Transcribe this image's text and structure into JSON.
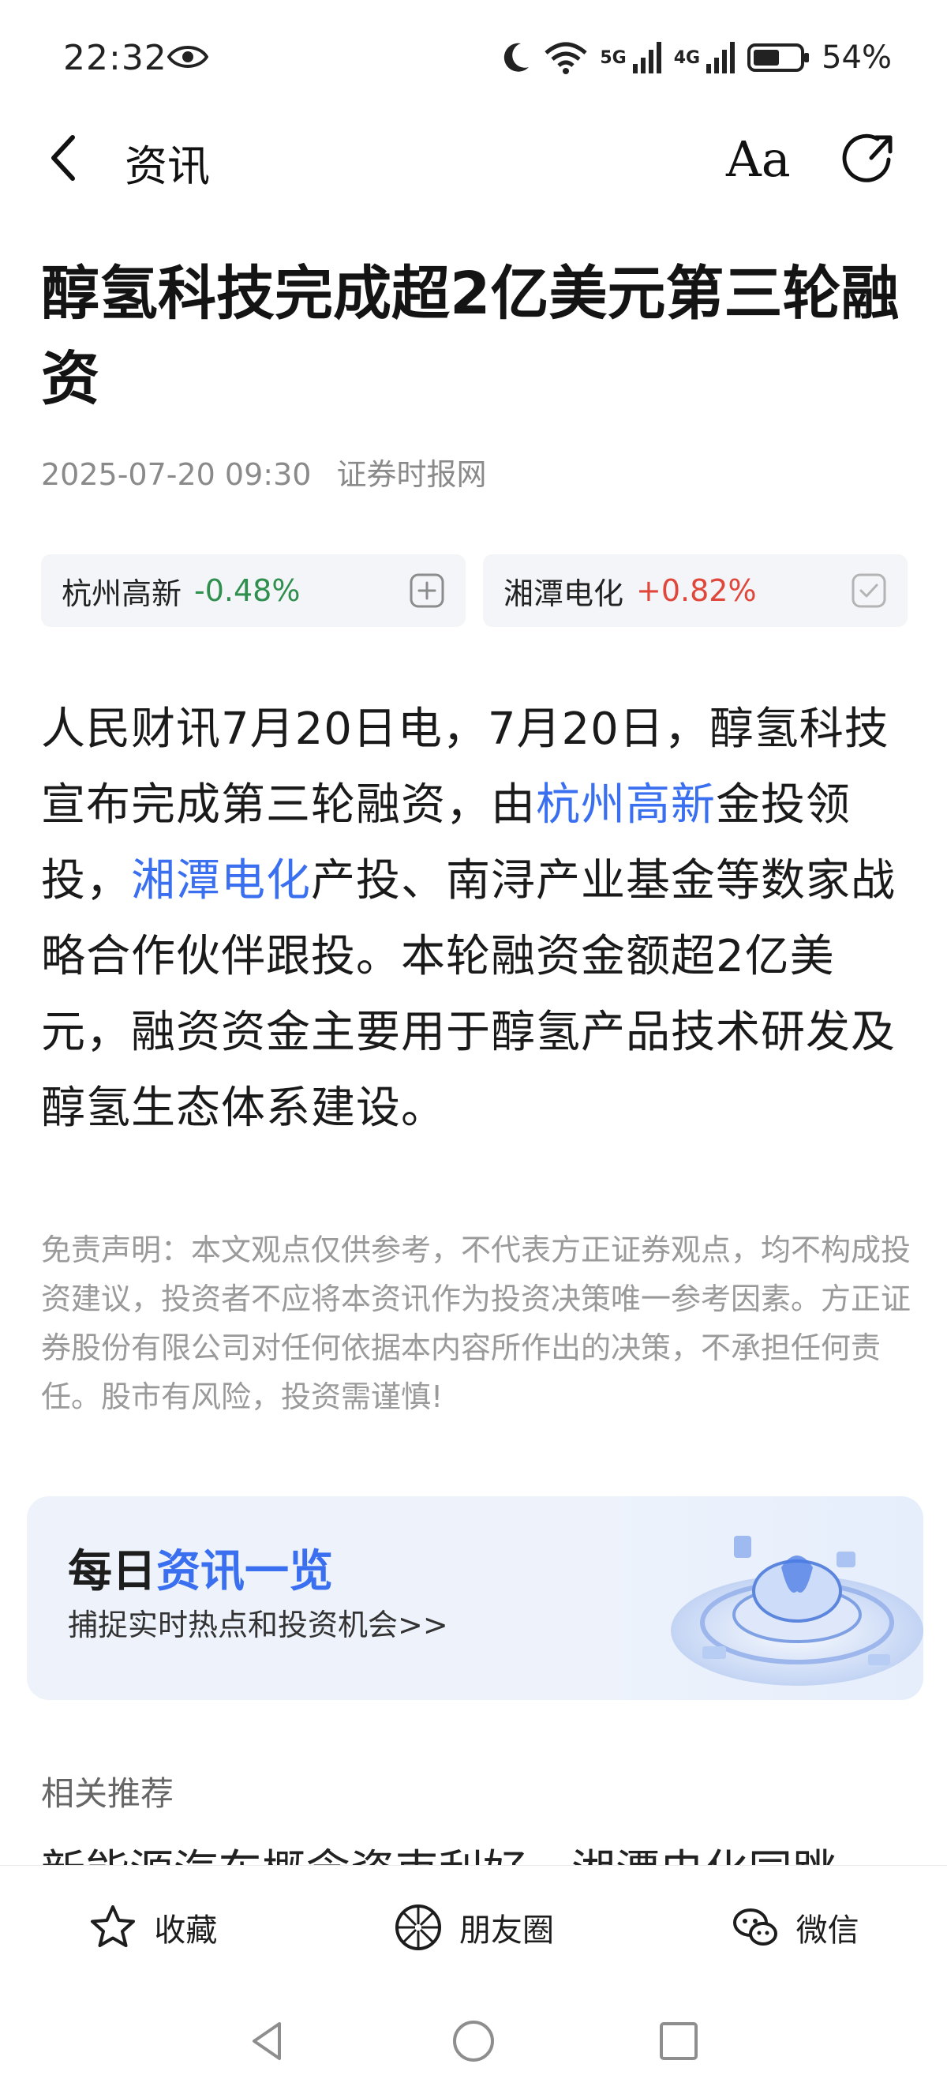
{
  "status_bar": {
    "time": "22:32",
    "net1": "5G",
    "net2": "4G",
    "battery": "54%"
  },
  "nav": {
    "title": "资讯",
    "font_icon_text": "Aa"
  },
  "article": {
    "title": "醇氢科技完成超2亿美元第三轮融资",
    "date": "2025-07-20 09:30",
    "source": "证券时报网",
    "stocks": [
      {
        "name": "杭州高新",
        "change": "-0.48%",
        "color": "#2f8f4e",
        "action": "add"
      },
      {
        "name": "湘潭电化",
        "change": "+0.82%",
        "color": "#e0463a",
        "action": "added"
      }
    ],
    "body": {
      "p1": "人民财讯7月20日电，7月20日，醇氢科技宣布完成第三轮融资，由",
      "link1": "杭州高新",
      "p2": "金投领投，",
      "link2": "湘潭电化",
      "p3": "产投、南浔产业基金等数家战略合作伙伴跟投。本轮融资金额超2亿美元，融资资金主要用于醇氢产品技术研发及醇氢生态体系建设。"
    },
    "disclaimer": "免责声明：本文观点仅供参考，不代表方正证券观点，均不构成投资建议，投资者不应将本资讯作为投资决策唯一参考因素。方正证券股份有限公司对任何依据本内容所作出的决策，不承担任何责任。股市有风险，投资需谨慎!"
  },
  "banner": {
    "title_a": "每日",
    "title_b": "资讯一览",
    "subtitle": "捕捉实时热点和投资机会>>"
  },
  "related": {
    "title": "相关推荐",
    "peek_text": "新能源汽车概念资束利好，湘潭电化同跳"
  },
  "bottom_bar": {
    "favorite": "收藏",
    "moments": "朋友圈",
    "wechat": "微信"
  },
  "colors": {
    "accent": "#3a6ff0",
    "down": "#2f8f4e",
    "up": "#e0463a"
  }
}
